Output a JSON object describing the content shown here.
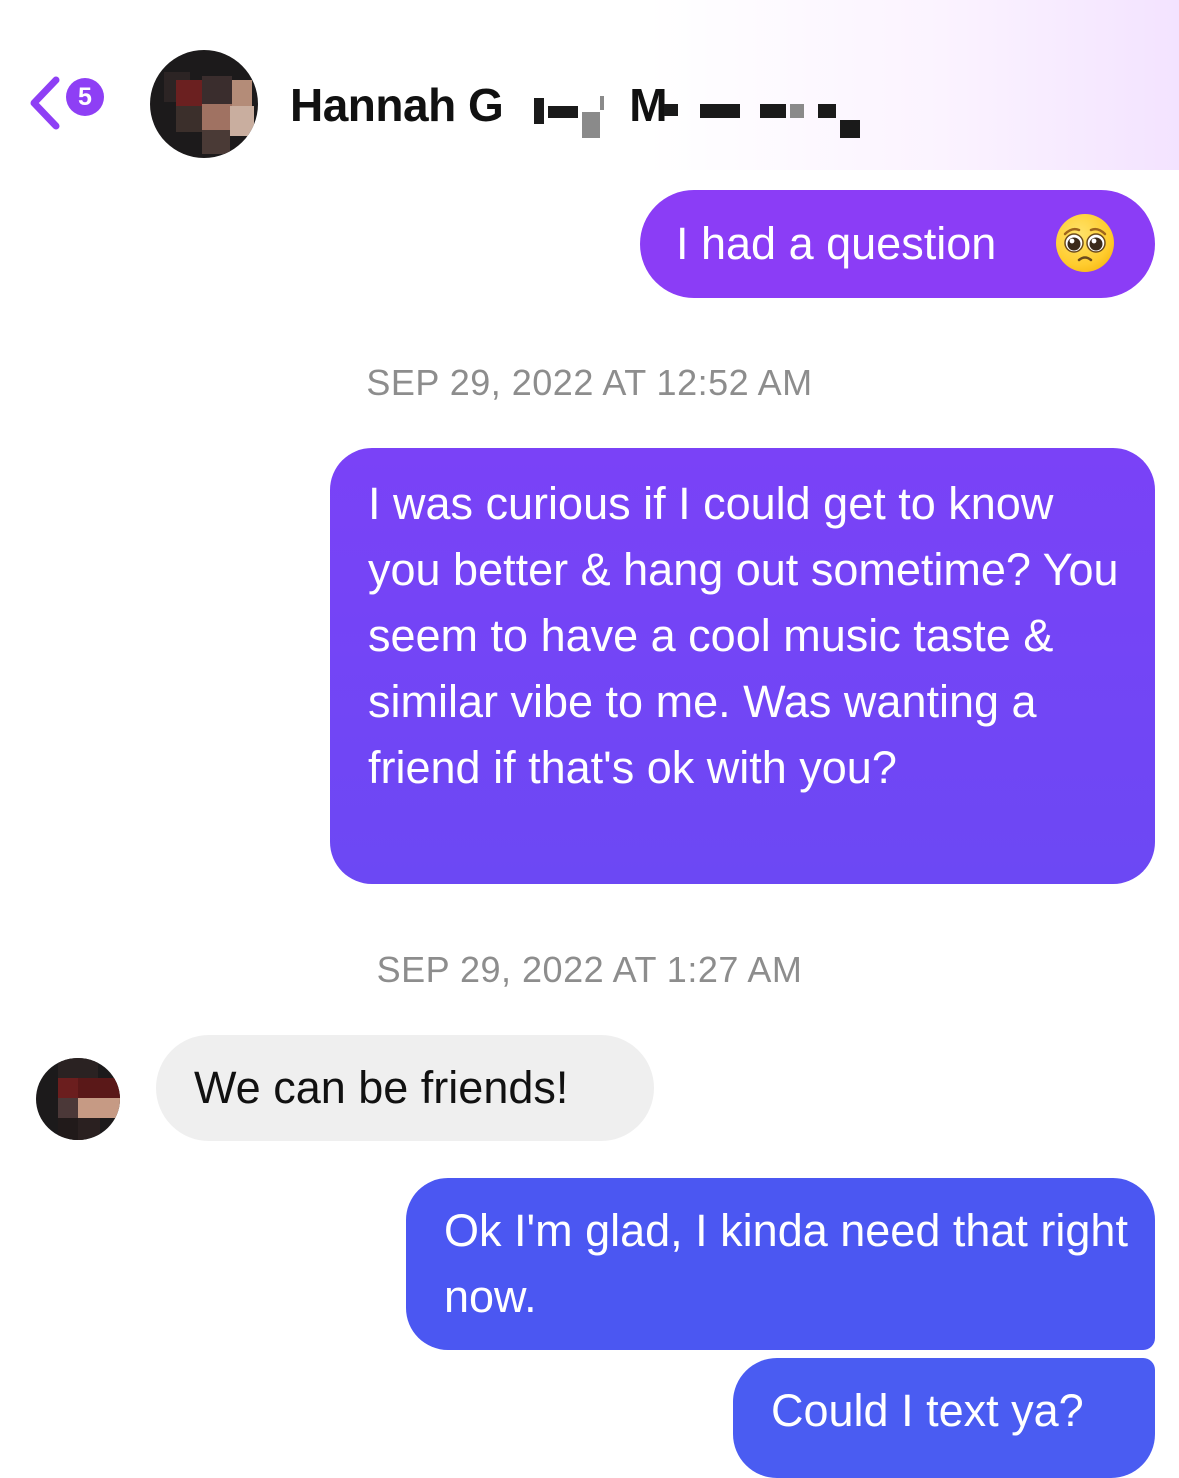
{
  "header": {
    "unread_count": "5",
    "contact_name_prefix": "Hannah G",
    "contact_name_mid": "M"
  },
  "messages": [
    {
      "direction": "outgoing",
      "text": "I had a question"
    },
    {
      "direction": "timestamp",
      "text": "SEP 29, 2022 AT 12:52 AM"
    },
    {
      "direction": "outgoing",
      "text": "I was curious if I could get to know you better & hang out sometime? You seem to have a cool music taste & similar vibe to me. Was wanting a friend if that's ok with you?"
    },
    {
      "direction": "timestamp",
      "text": "SEP 29, 2022 AT 1:27 AM"
    },
    {
      "direction": "incoming",
      "text": "We can be friends!"
    },
    {
      "direction": "outgoing",
      "text": "Ok I'm glad, I kinda need that right now."
    },
    {
      "direction": "outgoing",
      "text": "Could I text ya?"
    }
  ],
  "icons": {
    "back": "chevron-left-icon",
    "emoji": "pleading-face-emoji-icon"
  },
  "colors": {
    "accent": "#8e3ff5",
    "bubble_1": "#8b3df6",
    "bubble_2": "#6c48f4",
    "bubble_3": "#4b57f2",
    "incoming_bubble": "#efefef",
    "timestamp_text": "#8d8d8d"
  }
}
